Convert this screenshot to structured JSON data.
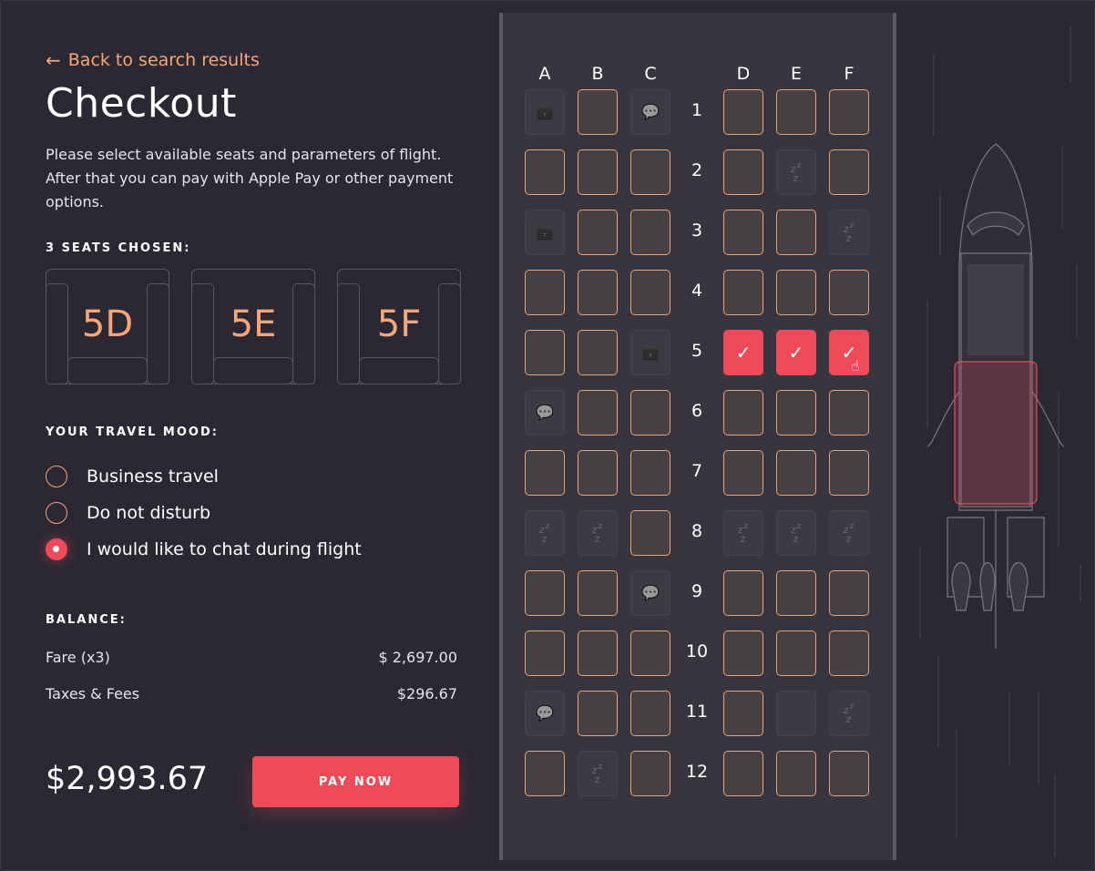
{
  "back_link": {
    "label": "Back to search results"
  },
  "title": "Checkout",
  "description": "Please select available seats and parameters of flight. After that you can pay with Apple Pay or other payment options.",
  "seats_section": {
    "label": "3 SEATS CHOSEN:",
    "chosen": [
      "5D",
      "5E",
      "5F"
    ]
  },
  "mood_section": {
    "label": "YOUR TRAVEL MOOD:",
    "options": [
      {
        "label": "Business travel",
        "selected": false
      },
      {
        "label": "Do not disturb",
        "selected": false
      },
      {
        "label": "I would like to chat during flight",
        "selected": true
      }
    ]
  },
  "balance": {
    "label": "BALANCE:",
    "rows": [
      {
        "label": "Fare (x3)",
        "value": "$ 2,697.00"
      },
      {
        "label": "Taxes & Fees",
        "value": "$296.67"
      }
    ],
    "total": "$2,993.67"
  },
  "pay_button": {
    "label": "PAY NOW"
  },
  "seat_map": {
    "columns_left": [
      "A",
      "B",
      "C"
    ],
    "columns_right": [
      "D",
      "E",
      "F"
    ],
    "rows": [
      {
        "number": "1",
        "seats": [
          "bag",
          "avail",
          "chat",
          "avail",
          "avail",
          "avail"
        ]
      },
      {
        "number": "2",
        "seats": [
          "avail",
          "avail",
          "avail",
          "avail",
          "sleep",
          "avail"
        ]
      },
      {
        "number": "3",
        "seats": [
          "bag",
          "avail",
          "avail",
          "avail",
          "avail",
          "sleep"
        ]
      },
      {
        "number": "4",
        "seats": [
          "avail",
          "avail",
          "avail",
          "avail",
          "avail",
          "avail"
        ]
      },
      {
        "number": "5",
        "seats": [
          "avail",
          "avail",
          "bag",
          "selected",
          "selected",
          "selected"
        ]
      },
      {
        "number": "6",
        "seats": [
          "chat",
          "avail",
          "avail",
          "avail",
          "avail",
          "avail"
        ]
      },
      {
        "number": "7",
        "seats": [
          "avail",
          "avail",
          "avail",
          "avail",
          "avail",
          "avail"
        ]
      },
      {
        "number": "8",
        "seats": [
          "sleep",
          "sleep",
          "avail",
          "sleep",
          "sleep",
          "sleep"
        ]
      },
      {
        "number": "9",
        "seats": [
          "avail",
          "avail",
          "chat",
          "avail",
          "avail",
          "avail"
        ]
      },
      {
        "number": "10",
        "seats": [
          "avail",
          "avail",
          "avail",
          "avail",
          "avail",
          "avail"
        ]
      },
      {
        "number": "11",
        "seats": [
          "chat",
          "avail",
          "avail",
          "avail",
          "empty",
          "sleep"
        ]
      },
      {
        "number": "12",
        "seats": [
          "avail",
          "sleep",
          "avail",
          "avail",
          "avail",
          "avail"
        ]
      }
    ]
  },
  "icons": {
    "bag": "briefcase-icon",
    "chat": "speech-bubble-icon",
    "sleep": "sleep-zz-icon",
    "selected": "checkmark-icon",
    "back": "arrow-left-icon"
  },
  "colors": {
    "background": "#2b2833",
    "accent": "#ef4a5a",
    "highlight": "#f5a67a",
    "cabin": "#38353f"
  }
}
